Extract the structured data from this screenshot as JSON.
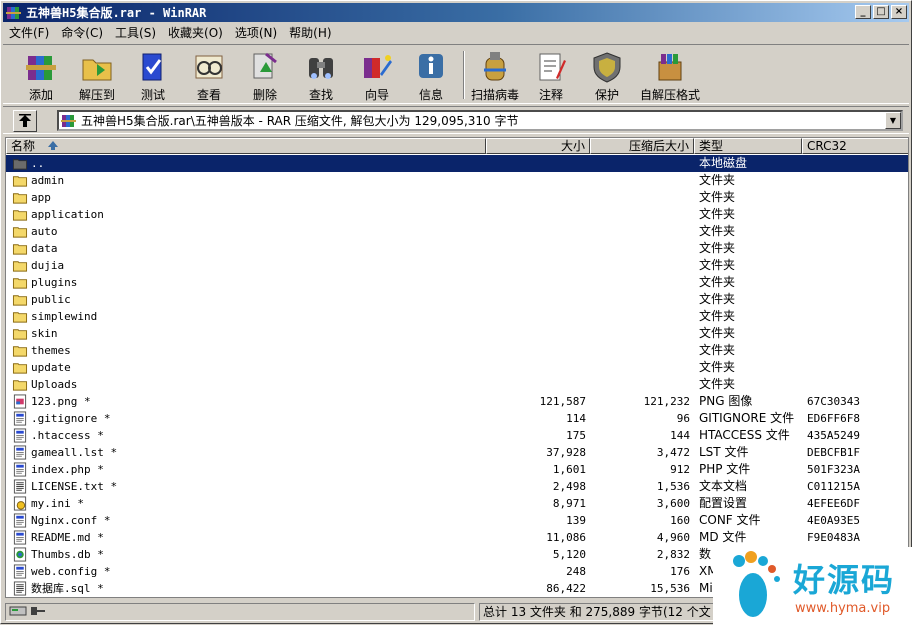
{
  "window": {
    "title": "五神兽H5集合版.rar - WinRAR",
    "min": "_",
    "max": "□",
    "close": "×"
  },
  "menu": [
    "文件(F)",
    "命令(C)",
    "工具(S)",
    "收藏夹(O)",
    "选项(N)",
    "帮助(H)"
  ],
  "toolbar": [
    {
      "label": "添加",
      "icon": "books-add-icon"
    },
    {
      "label": "解压到",
      "icon": "extract-folder-icon"
    },
    {
      "label": "测试",
      "icon": "test-book-icon"
    },
    {
      "label": "查看",
      "icon": "view-glasses-icon"
    },
    {
      "label": "删除",
      "icon": "delete-recycle-icon"
    },
    {
      "label": "查找",
      "icon": "binoculars-icon"
    },
    {
      "label": "向导",
      "icon": "wizard-icon"
    },
    {
      "label": "信息",
      "icon": "info-icon"
    },
    {
      "label": "扫描病毒",
      "icon": "virus-scan-icon"
    },
    {
      "label": "注释",
      "icon": "comment-icon"
    },
    {
      "label": "保护",
      "icon": "shield-icon"
    },
    {
      "label": "自解压格式",
      "icon": "sfx-icon"
    }
  ],
  "address": {
    "text": "五神兽H5集合版.rar\\五神兽版本 - RAR 压缩文件, 解包大小为 129,095,310 字节",
    "drop": "▼"
  },
  "columns": {
    "name": "名称",
    "size": "大小",
    "packed": "压缩后大小",
    "type": "类型",
    "crc": "CRC32"
  },
  "rows": [
    {
      "name": "..",
      "size": "",
      "packed": "",
      "type": "本地磁盘",
      "crc": "",
      "icon": "folder-up"
    },
    {
      "name": "admin",
      "size": "",
      "packed": "",
      "type": "文件夹",
      "crc": "",
      "icon": "folder"
    },
    {
      "name": "app",
      "size": "",
      "packed": "",
      "type": "文件夹",
      "crc": "",
      "icon": "folder"
    },
    {
      "name": "application",
      "size": "",
      "packed": "",
      "type": "文件夹",
      "crc": "",
      "icon": "folder"
    },
    {
      "name": "auto",
      "size": "",
      "packed": "",
      "type": "文件夹",
      "crc": "",
      "icon": "folder"
    },
    {
      "name": "data",
      "size": "",
      "packed": "",
      "type": "文件夹",
      "crc": "",
      "icon": "folder"
    },
    {
      "name": "dujia",
      "size": "",
      "packed": "",
      "type": "文件夹",
      "crc": "",
      "icon": "folder"
    },
    {
      "name": "plugins",
      "size": "",
      "packed": "",
      "type": "文件夹",
      "crc": "",
      "icon": "folder"
    },
    {
      "name": "public",
      "size": "",
      "packed": "",
      "type": "文件夹",
      "crc": "",
      "icon": "folder"
    },
    {
      "name": "simplewind",
      "size": "",
      "packed": "",
      "type": "文件夹",
      "crc": "",
      "icon": "folder"
    },
    {
      "name": "skin",
      "size": "",
      "packed": "",
      "type": "文件夹",
      "crc": "",
      "icon": "folder"
    },
    {
      "name": "themes",
      "size": "",
      "packed": "",
      "type": "文件夹",
      "crc": "",
      "icon": "folder"
    },
    {
      "name": "update",
      "size": "",
      "packed": "",
      "type": "文件夹",
      "crc": "",
      "icon": "folder"
    },
    {
      "name": "Uploads",
      "size": "",
      "packed": "",
      "type": "文件夹",
      "crc": "",
      "icon": "folder"
    },
    {
      "name": "123.png *",
      "size": "121,587",
      "packed": "121,232",
      "type": "PNG 图像",
      "crc": "67C30343",
      "icon": "image"
    },
    {
      "name": ".gitignore *",
      "size": "114",
      "packed": "96",
      "type": "GITIGNORE 文件",
      "crc": "ED6FF6F8",
      "icon": "file"
    },
    {
      "name": ".htaccess *",
      "size": "175",
      "packed": "144",
      "type": "HTACCESS 文件",
      "crc": "435A5249",
      "icon": "file"
    },
    {
      "name": "gameall.lst *",
      "size": "37,928",
      "packed": "3,472",
      "type": "LST 文件",
      "crc": "DEBCFB1F",
      "icon": "file"
    },
    {
      "name": "index.php *",
      "size": "1,601",
      "packed": "912",
      "type": "PHP 文件",
      "crc": "501F323A",
      "icon": "file"
    },
    {
      "name": "LICENSE.txt *",
      "size": "2,498",
      "packed": "1,536",
      "type": "文本文档",
      "crc": "C011215A",
      "icon": "text"
    },
    {
      "name": "my.ini *",
      "size": "8,971",
      "packed": "3,600",
      "type": "配置设置",
      "crc": "4EFEE6DF",
      "icon": "ini"
    },
    {
      "name": "Nginx.conf *",
      "size": "139",
      "packed": "160",
      "type": "CONF 文件",
      "crc": "4E0A93E5",
      "icon": "file"
    },
    {
      "name": "README.md *",
      "size": "11,086",
      "packed": "4,960",
      "type": "MD 文件",
      "crc": "F9E0483A",
      "icon": "file"
    },
    {
      "name": "Thumbs.db *",
      "size": "5,120",
      "packed": "2,832",
      "type": "数",
      "crc": "",
      "icon": "db"
    },
    {
      "name": "web.config *",
      "size": "248",
      "packed": "176",
      "type": "XMl",
      "crc": "",
      "icon": "file"
    },
    {
      "name": "数据库.sql *",
      "size": "86,422",
      "packed": "15,536",
      "type": "Mi",
      "crc": "",
      "icon": "text"
    }
  ],
  "status": {
    "left": "",
    "right": "总计 13 文件夹 和 275,889 字节(12 个文"
  },
  "watermark": {
    "text": "好源码",
    "url": "www.hyma.vip"
  },
  "colors": {
    "selection": "#0a246a",
    "folder": "#f4d86a",
    "watermark": "#1aa7d6"
  }
}
